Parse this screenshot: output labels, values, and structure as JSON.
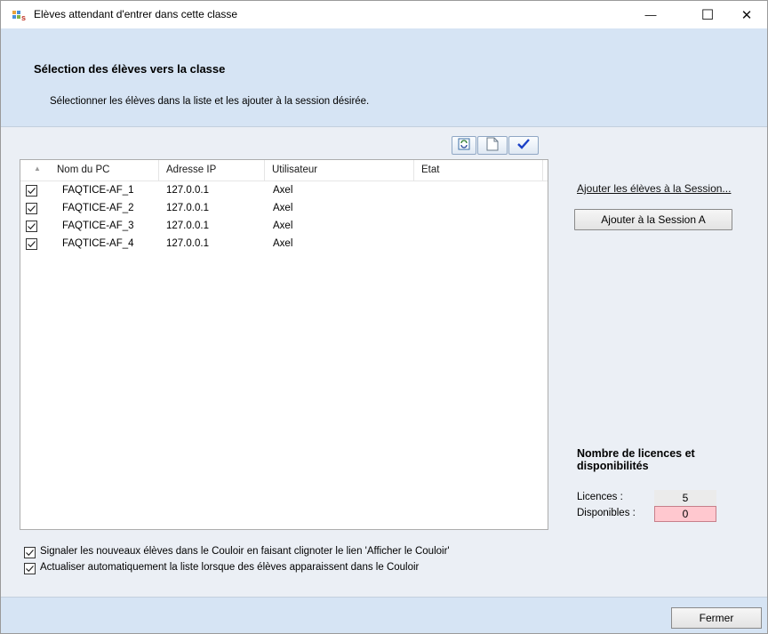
{
  "window": {
    "title": "Elèves attendant d'entrer dans cette classe",
    "minimize_glyph": "—",
    "maximize_glyph": "☐",
    "close_glyph": "✕"
  },
  "header": {
    "title": "Sélection des élèves vers la classe",
    "subtitle": "Sélectionner les élèves dans la liste et les ajouter à la session désirée."
  },
  "toolbar": {
    "icons": [
      "refresh-icon",
      "new-document-icon",
      "checkmark-icon"
    ]
  },
  "list": {
    "columns": [
      "Nom du PC",
      "Adresse IP",
      "Utilisateur",
      "Etat"
    ],
    "rows": [
      {
        "checked": true,
        "pc": "FAQTICE-AF_1",
        "ip": "127.0.0.1",
        "user": "Axel",
        "state": ""
      },
      {
        "checked": true,
        "pc": "FAQTICE-AF_2",
        "ip": "127.0.0.1",
        "user": "Axel",
        "state": ""
      },
      {
        "checked": true,
        "pc": "FAQTICE-AF_3",
        "ip": "127.0.0.1",
        "user": "Axel",
        "state": ""
      },
      {
        "checked": true,
        "pc": "FAQTICE-AF_4",
        "ip": "127.0.0.1",
        "user": "Axel",
        "state": ""
      }
    ]
  },
  "actions": {
    "add_link": "Ajouter les élèves à la Session...",
    "add_session_button": "Ajouter à la Session A"
  },
  "licences": {
    "title": "Nombre de licences et disponibilités",
    "licences_label": "Licences :",
    "licences_value": "5",
    "available_label": "Disponibles :",
    "available_value": "0"
  },
  "options": [
    {
      "checked": true,
      "label": "Signaler les nouveaux élèves dans le Couloir en faisant clignoter le lien 'Afficher le Couloir'"
    },
    {
      "checked": true,
      "label": "Actualiser automatiquement la liste lorsque des élèves apparaissent dans le Couloir"
    }
  ],
  "footer": {
    "close_button": "Fermer"
  },
  "colors": {
    "header_bg": "#d6e4f4",
    "client_bg": "#ebeff5",
    "dispo_bg": "#ffc8cf"
  }
}
